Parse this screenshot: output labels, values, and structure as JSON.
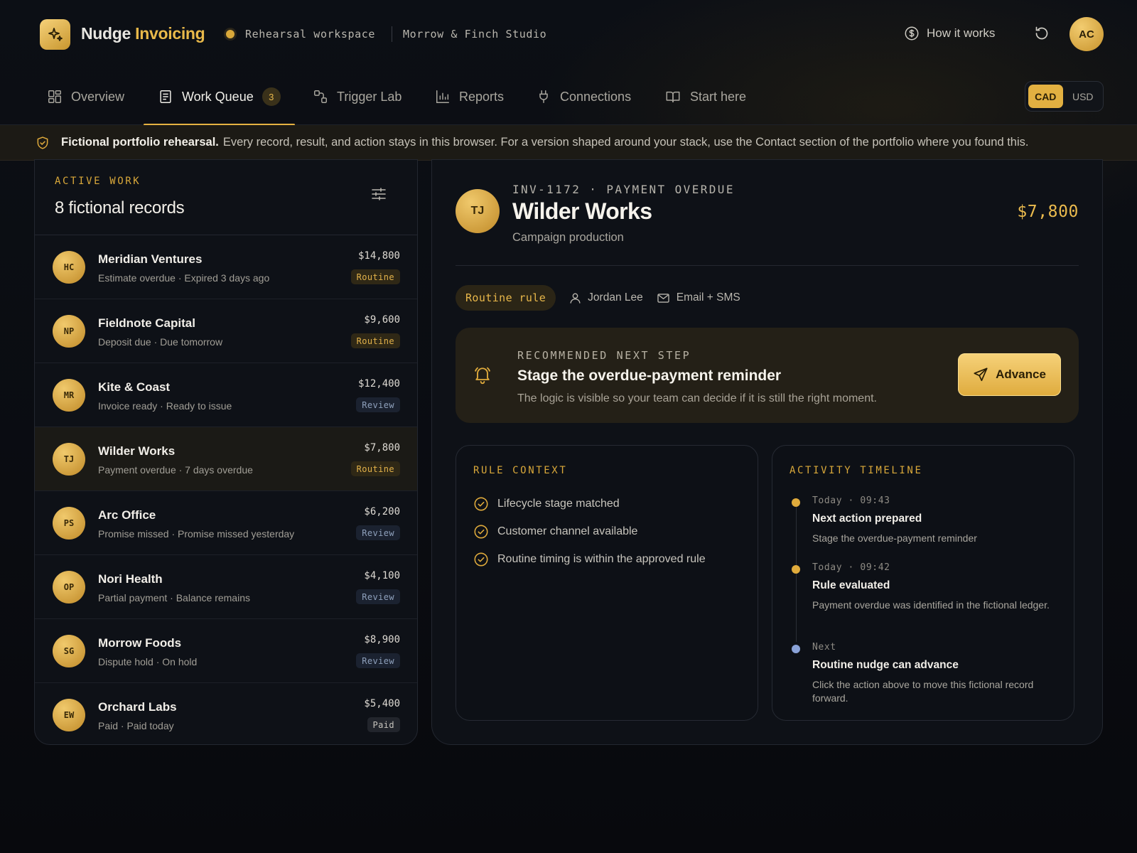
{
  "brand": {
    "name": "Nudge",
    "accent": "Invoicing"
  },
  "workspace": {
    "name": "Rehearsal workspace",
    "studio": "Morrow & Finch Studio"
  },
  "header": {
    "how_it_works": "How it works",
    "avatar": "AC"
  },
  "nav": {
    "overview": "Overview",
    "work_queue": "Work Queue",
    "work_queue_count": "3",
    "trigger_lab": "Trigger Lab",
    "reports": "Reports",
    "connections": "Connections",
    "start_here": "Start here"
  },
  "currency": {
    "cad": "CAD",
    "usd": "USD",
    "selected": "CAD"
  },
  "banner": {
    "bold": "Fictional portfolio rehearsal.",
    "text": "Every record, result, and action stays in this browser. For a version shaped around your stack, use the Contact section of the portfolio where you found this."
  },
  "active_work": {
    "eyebrow": "ACTIVE WORK",
    "count": "8 fictional records",
    "records": [
      {
        "initials": "HC",
        "name": "Meridian Ventures",
        "sub": "Estimate overdue · Expired 3 days ago",
        "amount": "$14,800",
        "status": "Routine"
      },
      {
        "initials": "NP",
        "name": "Fieldnote Capital",
        "sub": "Deposit due · Due tomorrow",
        "amount": "$9,600",
        "status": "Routine"
      },
      {
        "initials": "MR",
        "name": "Kite & Coast",
        "sub": "Invoice ready · Ready to issue",
        "amount": "$12,400",
        "status": "Review"
      },
      {
        "initials": "TJ",
        "name": "Wilder Works",
        "sub": "Payment overdue · 7 days overdue",
        "amount": "$7,800",
        "status": "Routine"
      },
      {
        "initials": "PS",
        "name": "Arc Office",
        "sub": "Promise missed · Promise missed yesterday",
        "amount": "$6,200",
        "status": "Review"
      },
      {
        "initials": "OP",
        "name": "Nori Health",
        "sub": "Partial payment · Balance remains",
        "amount": "$4,100",
        "status": "Review"
      },
      {
        "initials": "SG",
        "name": "Morrow Foods",
        "sub": "Dispute hold · On hold",
        "amount": "$8,900",
        "status": "Review"
      },
      {
        "initials": "EW",
        "name": "Orchard Labs",
        "sub": "Paid · Paid today",
        "amount": "$5,400",
        "status": "Paid"
      }
    ]
  },
  "detail": {
    "initials": "TJ",
    "code": "INV-1172 · PAYMENT OVERDUE",
    "title": "Wilder Works",
    "subtitle": "Campaign production",
    "amount": "$7,800",
    "rule_chip": "Routine rule",
    "owner": "Jordan Lee",
    "channel": "Email + SMS",
    "recommendation": {
      "eyebrow": "RECOMMENDED NEXT STEP",
      "title": "Stage the overdue-payment reminder",
      "desc": "The logic is visible so your team can decide if it is still the right moment.",
      "action": "Advance"
    },
    "rule_context": {
      "eyebrow": "RULE CONTEXT",
      "items": [
        "Lifecycle stage matched",
        "Customer channel available",
        "Routine timing is within the approved rule"
      ]
    },
    "timeline": {
      "eyebrow": "ACTIVITY TIMELINE",
      "entries": [
        {
          "time": "Today · 09:43",
          "title": "Next action prepared",
          "desc": "Stage the overdue-payment reminder"
        },
        {
          "time": "Today · 09:42",
          "title": "Rule evaluated",
          "desc": "Payment overdue was identified in the fictional ledger."
        },
        {
          "time": "Next",
          "title": "Routine nudge can advance",
          "desc": "Click the action above to move this fictional record forward."
        }
      ]
    }
  },
  "colors": {
    "accent": "#e5b141",
    "background": "#0b0d12",
    "panel": "#0e1117",
    "next_dot": "#8aa2d8"
  }
}
